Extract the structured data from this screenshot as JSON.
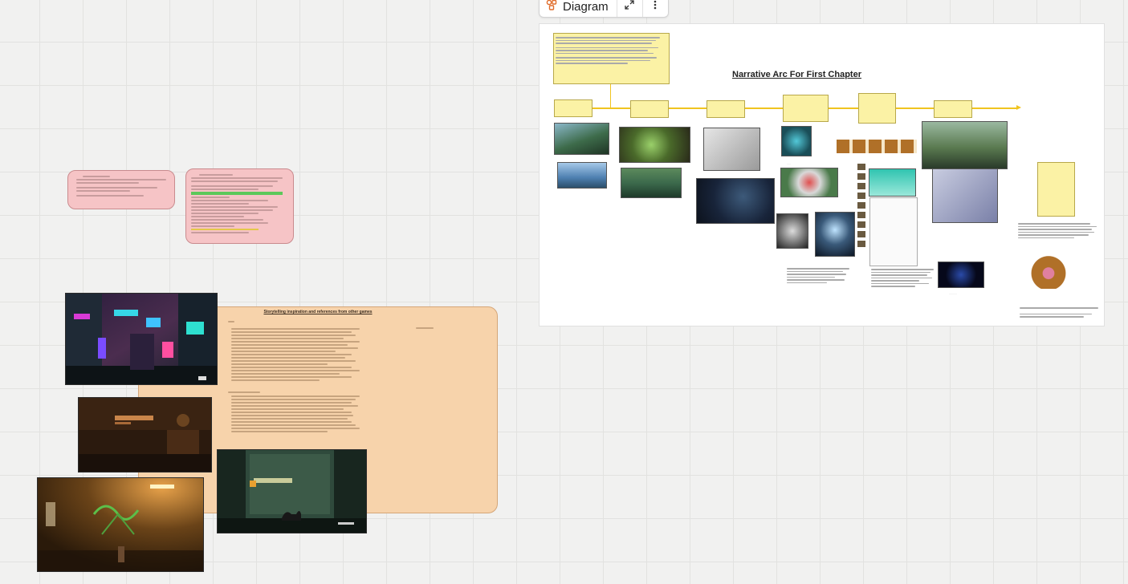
{
  "toolbar": {
    "diagram_label": "Diagram",
    "icons": [
      "diagram-icon",
      "expand-icon",
      "more-vertical-icon"
    ]
  },
  "diagram_panel": {
    "title": "Narrative Arc For First Chapter"
  },
  "peach_note": {
    "title": "Storytelling inspiration and references from other games"
  },
  "colors": {
    "canvas": "#f1f1f0",
    "grid": "#e2e2e0",
    "pink_note": "#f6c4c6",
    "peach_note": "#f7d3ab",
    "yellow_note": "#fbf2a5",
    "timeline": "#f0c420"
  }
}
